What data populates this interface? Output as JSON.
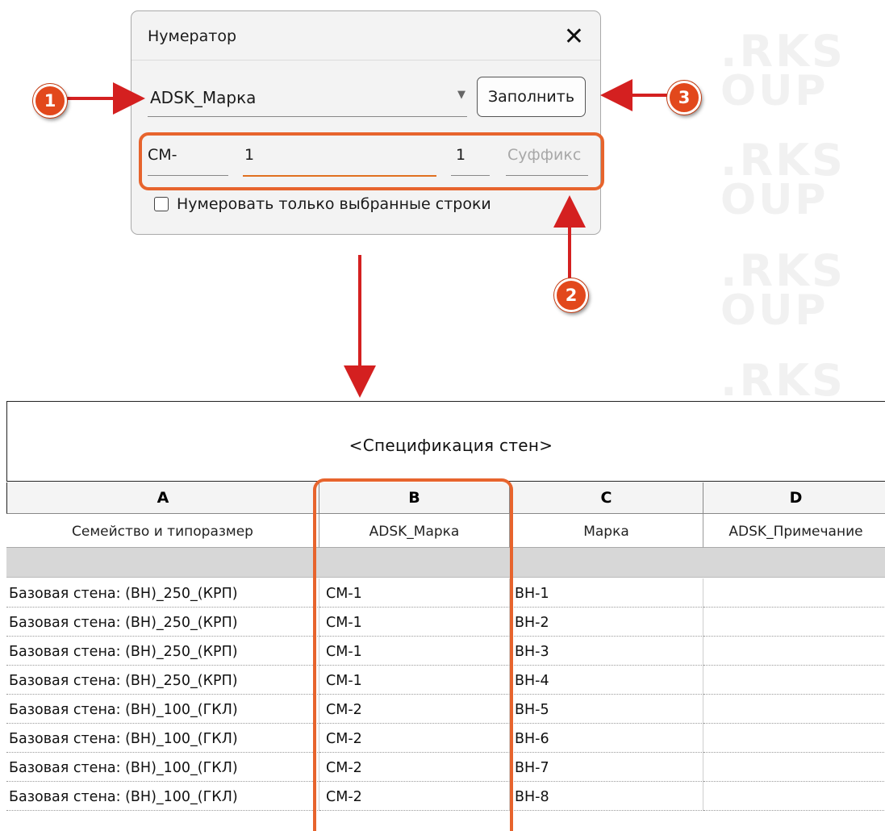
{
  "dialog": {
    "title": "Нумератор",
    "close_glyph": "✕",
    "parameter": "ADSK_Марка",
    "dropdown_glyph": "▼",
    "fill_button": "Заполнить",
    "prefix": "СМ-",
    "start_number": "1",
    "step": "1",
    "suffix_placeholder": "Суффикс",
    "selected_only_label": "Нумеровать только выбранные строки",
    "selected_only_checked": false
  },
  "badges": [
    "1",
    "2",
    "3"
  ],
  "schedule": {
    "title": "<Спецификация стен>",
    "column_letters": [
      "A",
      "B",
      "C",
      "D"
    ],
    "column_names": [
      "Семейство и типоразмер",
      "ADSK_Марка",
      "Марка",
      "ADSK_Примечание"
    ],
    "rows": [
      [
        "Базовая стена: (ВН)_250_(КРП)",
        "СМ-1",
        "ВН-1",
        ""
      ],
      [
        "Базовая стена: (ВН)_250_(КРП)",
        "СМ-1",
        "ВН-2",
        ""
      ],
      [
        "Базовая стена: (ВН)_250_(КРП)",
        "СМ-1",
        "ВН-3",
        ""
      ],
      [
        "Базовая стена: (ВН)_250_(КРП)",
        "СМ-1",
        "ВН-4",
        ""
      ],
      [
        "Базовая стена: (ВН)_100_(ГКЛ)",
        "СМ-2",
        "ВН-5",
        ""
      ],
      [
        "Базовая стена: (ВН)_100_(ГКЛ)",
        "СМ-2",
        "ВН-6",
        ""
      ],
      [
        "Базовая стена: (ВН)_100_(ГКЛ)",
        "СМ-2",
        "ВН-7",
        ""
      ],
      [
        "Базовая стена: (ВН)_100_(ГКЛ)",
        "СМ-2",
        "ВН-8",
        ""
      ]
    ]
  },
  "colors": {
    "highlight": "#e7642d",
    "arrow": "#d42020",
    "badge": "#e2481c"
  }
}
